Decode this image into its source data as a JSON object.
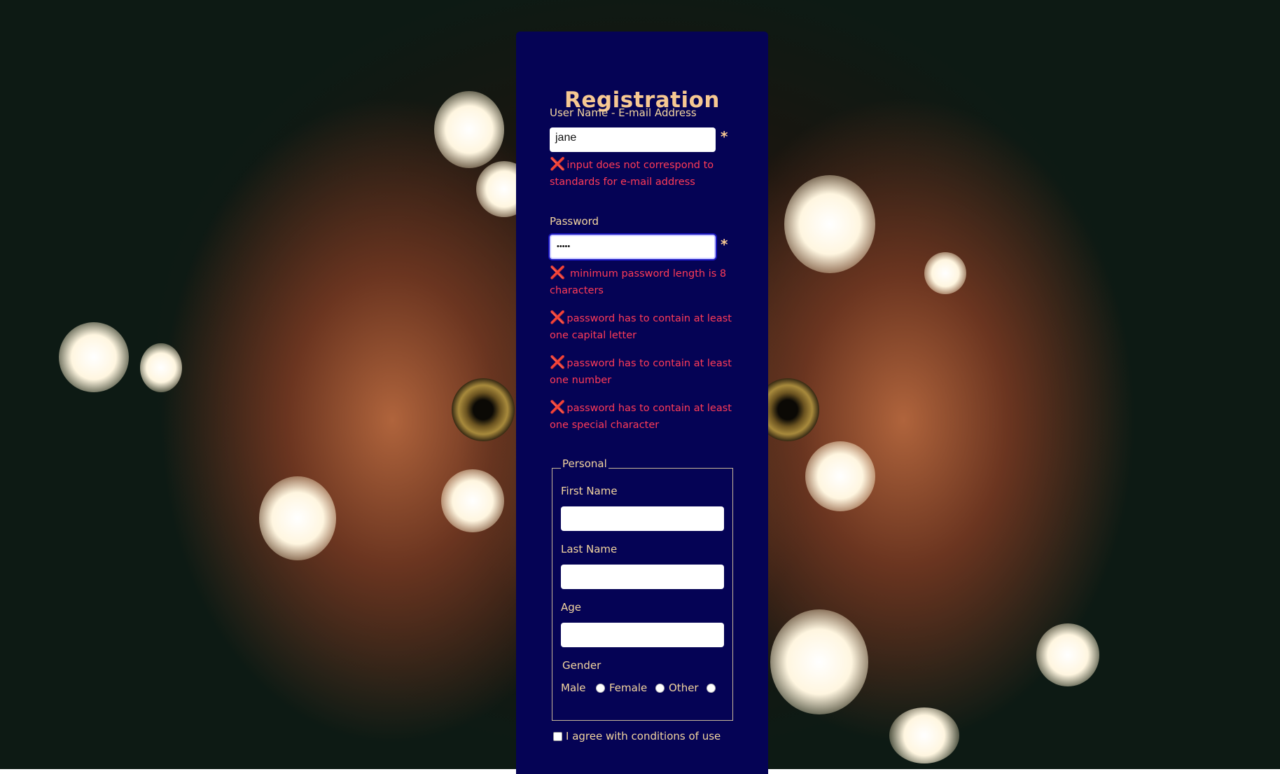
{
  "form": {
    "title": "Registration",
    "username": {
      "label": "User Name - E-mail Address",
      "value": "jane",
      "required_mark": "*",
      "errors": [
        {
          "icon": "❌",
          "text": "input does not correspond to standards for e-mail address"
        }
      ]
    },
    "password": {
      "label": "Password",
      "value": "•••••",
      "required_mark": "*",
      "errors": [
        {
          "icon": "❌",
          "text": " minimum password length is 8 characters"
        },
        {
          "icon": "❌",
          "text": "password has to contain at least one capital letter"
        },
        {
          "icon": "❌",
          "text": "password has to contain at least one number"
        },
        {
          "icon": "❌",
          "text": "password has to contain at least one special character"
        }
      ]
    },
    "personal": {
      "legend": "Personal",
      "first_name_label": "First Name",
      "first_name_value": "",
      "last_name_label": "Last Name",
      "last_name_value": "",
      "age_label": "Age",
      "age_value": "",
      "gender_label": "Gender",
      "gender_options": [
        "Male",
        "Female",
        "Other"
      ]
    },
    "agree_label": "I agree with conditions of use"
  },
  "colors": {
    "panel": "#050355",
    "label": "#f4d6a0",
    "title": "#f6c892",
    "error": "#ff3b57"
  }
}
